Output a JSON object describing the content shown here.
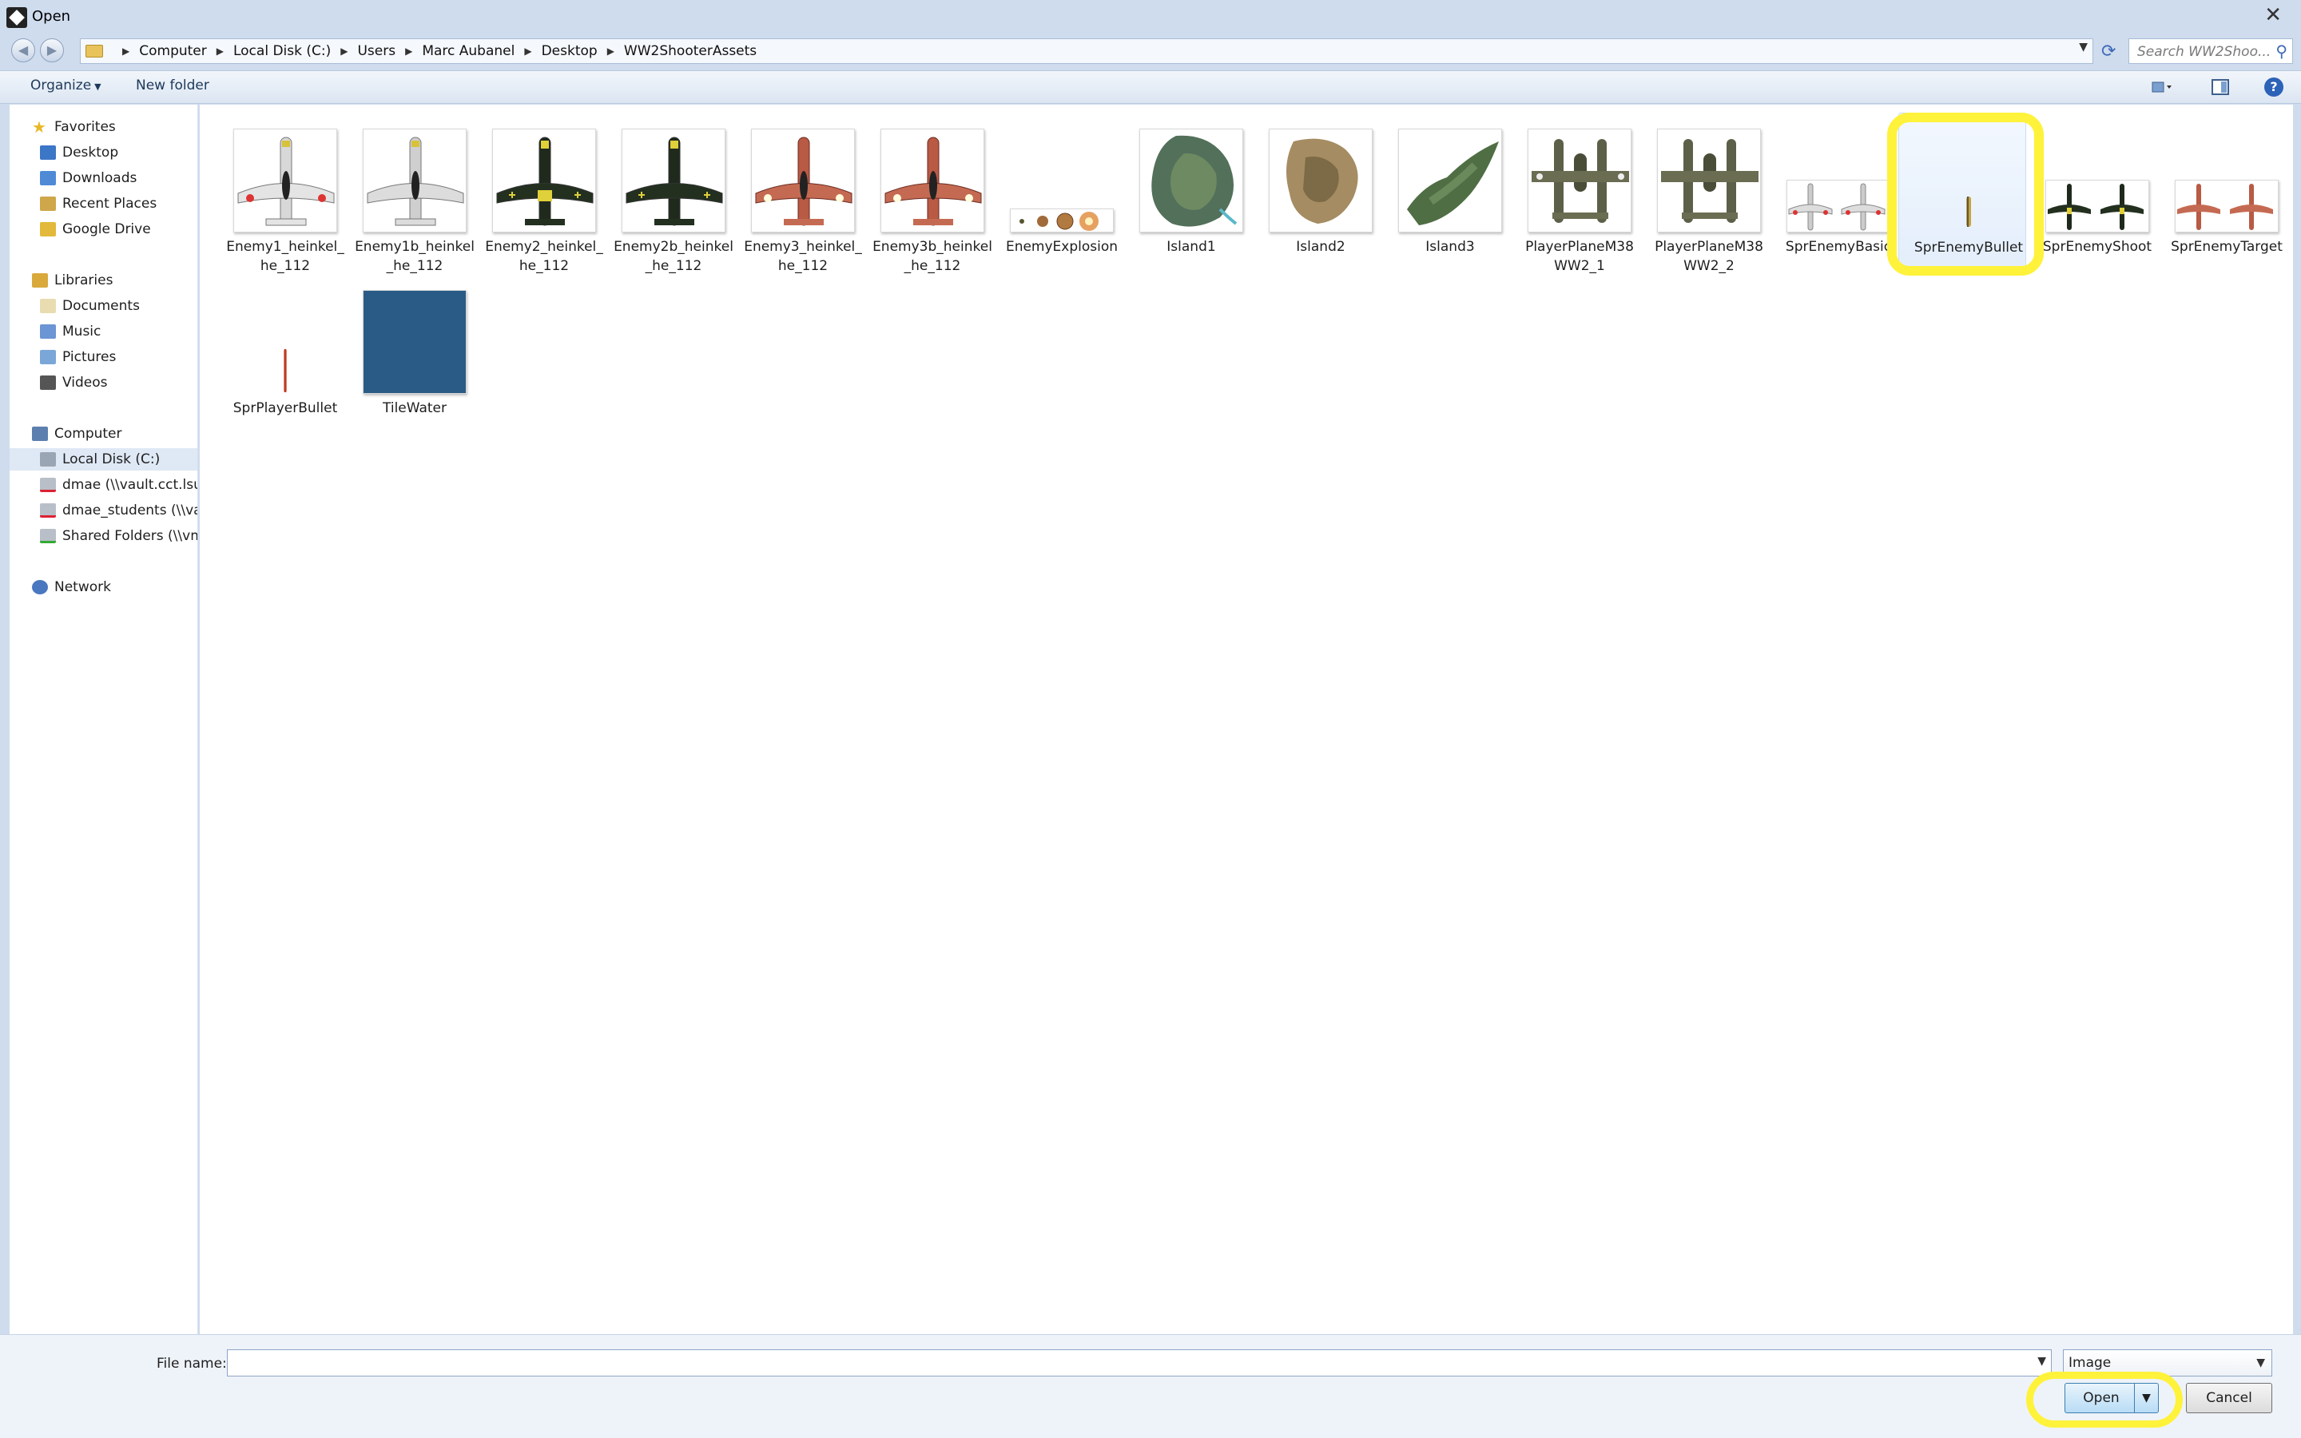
{
  "window": {
    "title": "Open"
  },
  "address": {
    "breadcrumbs": [
      "Computer",
      "Local Disk (C:)",
      "Users",
      "Marc Aubanel",
      "Desktop",
      "WW2ShooterAssets"
    ],
    "search_placeholder": "Search WW2Shoo..."
  },
  "toolbar": {
    "organize_label": "Organize",
    "new_folder_label": "New folder"
  },
  "nav": {
    "favorites": {
      "label": "Favorites",
      "items": [
        "Desktop",
        "Downloads",
        "Recent Places",
        "Google Drive"
      ]
    },
    "libraries": {
      "label": "Libraries",
      "items": [
        "Documents",
        "Music",
        "Pictures",
        "Videos"
      ]
    },
    "computer": {
      "label": "Computer",
      "items": [
        "Local Disk (C:)",
        "dmae (\\\\vault.cct.lsu.e",
        "dmae_students (\\\\vau",
        "Shared Folders (\\\\vm"
      ]
    },
    "network": {
      "label": "Network"
    }
  },
  "files": [
    {
      "name": "Enemy1_heinkel_he_112",
      "line1": "Enemy1_heinkel_",
      "line2": "he_112"
    },
    {
      "name": "Enemy1b_heinkel_he_112",
      "line1": "Enemy1b_heinkel",
      "line2": "_he_112"
    },
    {
      "name": "Enemy2_heinkel_he_112",
      "line1": "Enemy2_heinkel_",
      "line2": "he_112"
    },
    {
      "name": "Enemy2b_heinkel_he_112",
      "line1": "Enemy2b_heinkel",
      "line2": "_he_112"
    },
    {
      "name": "Enemy3_heinkel_he_112",
      "line1": "Enemy3_heinkel_",
      "line2": "he_112"
    },
    {
      "name": "Enemy3b_heinkel_he_112",
      "line1": "Enemy3b_heinkel",
      "line2": "_he_112"
    },
    {
      "name": "EnemyExplosion",
      "line1": "EnemyExplosion",
      "line2": ""
    },
    {
      "name": "Island1",
      "line1": "Island1",
      "line2": ""
    },
    {
      "name": "Island2",
      "line1": "Island2",
      "line2": ""
    },
    {
      "name": "Island3",
      "line1": "Island3",
      "line2": ""
    },
    {
      "name": "PlayerPlaneM38WW2_1",
      "line1": "PlayerPlaneM38",
      "line2": "WW2_1"
    },
    {
      "name": "PlayerPlaneM38WW2_2",
      "line1": "PlayerPlaneM38",
      "line2": "WW2_2"
    },
    {
      "name": "SprEnemyBasic",
      "line1": "SprEnemyBasic",
      "line2": ""
    },
    {
      "name": "SprEnemyBullet",
      "line1": "SprEnemyBullet",
      "line2": ""
    },
    {
      "name": "SprEnemyShoot",
      "line1": "SprEnemyShoot",
      "line2": ""
    },
    {
      "name": "SprEnemyTarget",
      "line1": "SprEnemyTarget",
      "line2": ""
    },
    {
      "name": "SprPlayerBullet",
      "line1": "SprPlayerBullet",
      "line2": ""
    },
    {
      "name": "TileWater",
      "line1": "TileWater",
      "line2": ""
    }
  ],
  "bottom": {
    "file_name_label": "File name:",
    "file_name_value": "",
    "file_type_value": "Image",
    "open_label": "Open",
    "cancel_label": "Cancel"
  },
  "colors": {
    "highlight_ring": "#fff23a",
    "accent": "#2c62b8",
    "water": "#2a5b86"
  }
}
